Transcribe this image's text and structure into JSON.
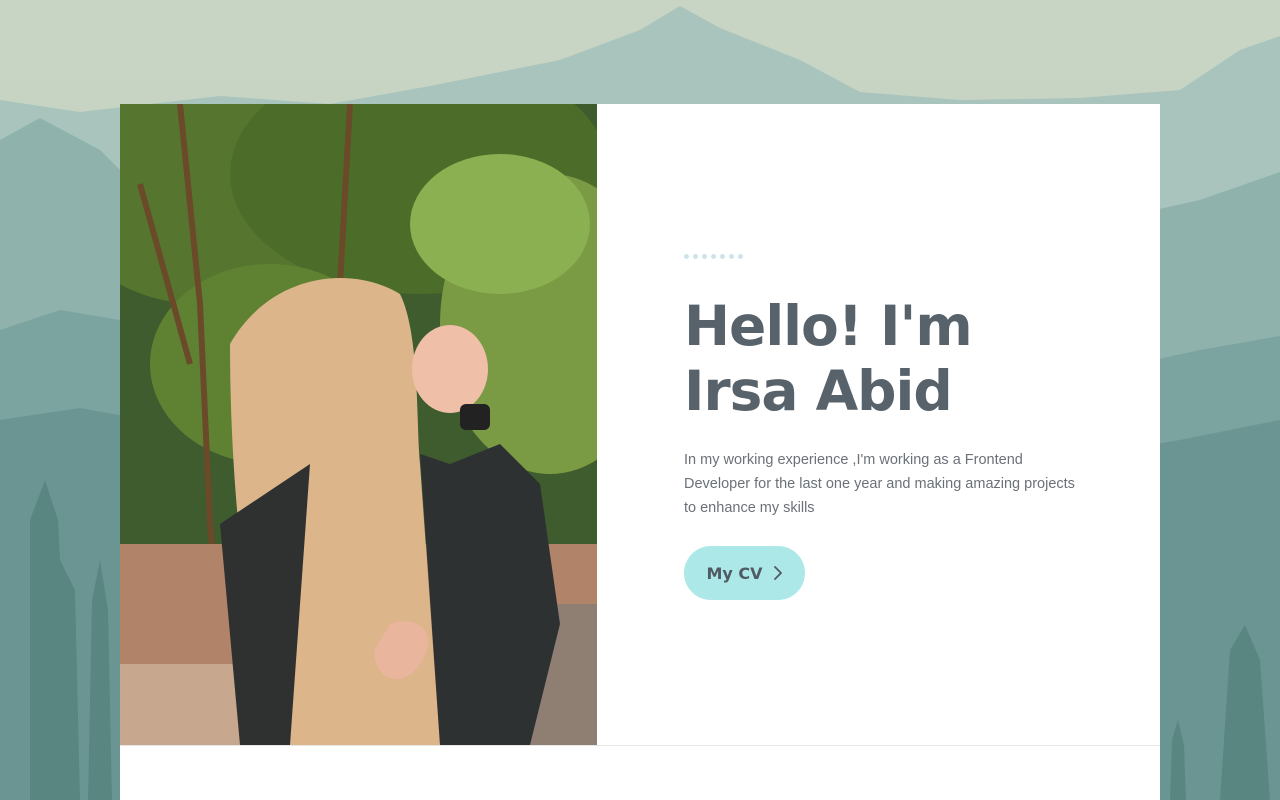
{
  "hero": {
    "title_line1": "Hello! I'm",
    "title_line2": "Irsa Abid",
    "description": "In my working experience ,I'm working as a Frontend Developer for the last one year and making amazing projects to enhance my skills",
    "cv_button_label": "My CV",
    "dots_count": 7
  },
  "icons": {
    "cv_button": "chevron-right-icon"
  },
  "colors": {
    "title": "#58626b",
    "text": "#6b7178",
    "button_bg": "#ade8e9",
    "dots": "#cfe3ea",
    "mountains": "#6f9a97"
  }
}
